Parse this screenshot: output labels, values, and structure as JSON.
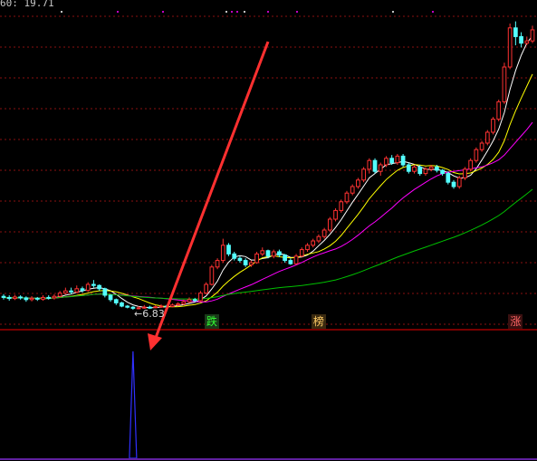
{
  "header": {
    "text": "60: 19.71"
  },
  "chart_data": [
    {
      "type": "candlestick",
      "title": "",
      "price_range": [
        6.5,
        20.5
      ],
      "low_label": "6.83",
      "candles": [
        [
          7.45,
          7.4,
          7.55,
          7.3
        ],
        [
          7.4,
          7.35,
          7.5,
          7.25
        ],
        [
          7.35,
          7.42,
          7.52,
          7.28
        ],
        [
          7.42,
          7.38,
          7.5,
          7.3
        ],
        [
          7.38,
          7.3,
          7.45,
          7.2
        ],
        [
          7.3,
          7.36,
          7.46,
          7.22
        ],
        [
          7.36,
          7.32,
          7.42,
          7.24
        ],
        [
          7.32,
          7.4,
          7.5,
          7.25
        ],
        [
          7.4,
          7.38,
          7.5,
          7.3
        ],
        [
          7.38,
          7.45,
          7.55,
          7.3
        ],
        [
          7.45,
          7.6,
          7.7,
          7.4
        ],
        [
          7.6,
          7.7,
          7.85,
          7.55
        ],
        [
          7.7,
          7.65,
          7.85,
          7.55
        ],
        [
          7.65,
          7.8,
          7.95,
          7.6
        ],
        [
          7.8,
          7.72,
          7.9,
          7.62
        ],
        [
          7.72,
          8.0,
          8.1,
          7.65
        ],
        [
          8.0,
          7.95,
          8.2,
          7.85
        ],
        [
          7.95,
          7.8,
          8.0,
          7.7
        ],
        [
          7.8,
          7.5,
          7.85,
          7.4
        ],
        [
          7.5,
          7.3,
          7.55,
          7.2
        ],
        [
          7.3,
          7.15,
          7.35,
          7.05
        ],
        [
          7.15,
          7.0,
          7.2,
          6.95
        ],
        [
          7.0,
          6.95,
          7.05,
          6.9
        ],
        [
          6.95,
          6.9,
          7.0,
          6.83
        ],
        [
          6.9,
          6.92,
          7.0,
          6.85
        ],
        [
          6.92,
          6.95,
          7.05,
          6.88
        ],
        [
          6.95,
          6.93,
          7.02,
          6.87
        ],
        [
          6.93,
          6.97,
          7.05,
          6.9
        ],
        [
          6.97,
          7.0,
          7.08,
          6.92
        ],
        [
          7.0,
          6.98,
          7.06,
          6.94
        ],
        [
          6.98,
          7.05,
          7.12,
          6.95
        ],
        [
          7.05,
          7.1,
          7.18,
          7.0
        ],
        [
          7.1,
          7.2,
          7.3,
          7.05
        ],
        [
          7.2,
          7.3,
          7.4,
          7.15
        ],
        [
          7.3,
          7.25,
          7.38,
          7.18
        ],
        [
          7.25,
          7.6,
          7.7,
          7.2
        ],
        [
          7.6,
          8.0,
          8.1,
          7.55
        ],
        [
          8.0,
          8.8,
          8.9,
          7.95
        ],
        [
          8.8,
          9.1,
          9.2,
          8.7
        ],
        [
          9.1,
          9.8,
          10.1,
          9.0
        ],
        [
          9.8,
          9.4,
          9.9,
          9.3
        ],
        [
          9.4,
          9.2,
          9.5,
          9.1
        ],
        [
          9.2,
          9.1,
          9.3,
          9.0
        ],
        [
          9.1,
          8.9,
          9.2,
          8.8
        ],
        [
          8.9,
          9.0,
          9.1,
          8.8
        ],
        [
          9.0,
          9.4,
          9.5,
          8.95
        ],
        [
          9.4,
          9.55,
          9.7,
          9.3
        ],
        [
          9.55,
          9.3,
          9.6,
          9.2
        ],
        [
          9.3,
          9.5,
          9.6,
          9.2
        ],
        [
          9.5,
          9.35,
          9.6,
          9.25
        ],
        [
          9.35,
          9.1,
          9.4,
          9.0
        ],
        [
          9.1,
          8.95,
          9.2,
          8.9
        ],
        [
          8.95,
          9.3,
          9.4,
          8.9
        ],
        [
          9.3,
          9.6,
          9.7,
          9.25
        ],
        [
          9.6,
          9.8,
          9.9,
          9.5
        ],
        [
          9.8,
          10.0,
          10.1,
          9.7
        ],
        [
          10.0,
          10.2,
          10.3,
          9.9
        ],
        [
          10.2,
          10.5,
          10.6,
          10.1
        ],
        [
          10.5,
          11.0,
          11.1,
          10.4
        ],
        [
          11.0,
          11.4,
          11.5,
          10.9
        ],
        [
          11.4,
          11.8,
          11.9,
          11.3
        ],
        [
          11.8,
          12.2,
          12.3,
          11.7
        ],
        [
          12.2,
          12.5,
          12.6,
          12.1
        ],
        [
          12.5,
          12.8,
          12.9,
          12.4
        ],
        [
          12.8,
          13.3,
          13.4,
          12.7
        ],
        [
          13.3,
          13.7,
          13.8,
          13.1
        ],
        [
          13.7,
          13.2,
          13.8,
          13.1
        ],
        [
          13.2,
          13.5,
          13.6,
          13.0
        ],
        [
          13.5,
          13.8,
          13.9,
          13.4
        ],
        [
          13.8,
          13.6,
          13.95,
          13.5
        ],
        [
          13.6,
          13.9,
          14.0,
          13.5
        ],
        [
          13.9,
          13.5,
          14.0,
          13.4
        ],
        [
          13.5,
          13.2,
          13.6,
          13.1
        ],
        [
          13.2,
          13.4,
          13.5,
          13.1
        ],
        [
          13.4,
          13.1,
          13.5,
          13.0
        ],
        [
          13.1,
          13.3,
          13.4,
          13.0
        ],
        [
          13.3,
          13.4,
          13.5,
          13.2
        ],
        [
          13.4,
          13.25,
          13.5,
          13.15
        ],
        [
          13.25,
          13.1,
          13.3,
          13.0
        ],
        [
          13.1,
          12.7,
          13.2,
          12.6
        ],
        [
          12.7,
          12.5,
          12.8,
          12.4
        ],
        [
          12.5,
          12.9,
          13.0,
          12.4
        ],
        [
          12.9,
          13.3,
          13.4,
          12.8
        ],
        [
          13.3,
          13.7,
          13.8,
          13.2
        ],
        [
          13.7,
          14.2,
          14.3,
          13.6
        ],
        [
          14.2,
          14.5,
          14.6,
          14.1
        ],
        [
          14.5,
          15.0,
          15.1,
          14.4
        ],
        [
          15.0,
          15.6,
          15.7,
          14.9
        ],
        [
          15.6,
          16.4,
          16.5,
          15.5
        ],
        [
          16.4,
          18.0,
          18.2,
          16.3
        ],
        [
          18.0,
          19.8,
          20.0,
          17.9
        ],
        [
          19.8,
          19.4,
          20.1,
          19.0
        ],
        [
          19.4,
          19.1,
          19.6,
          18.9
        ],
        [
          19.1,
          19.2,
          19.4,
          19.0
        ],
        [
          19.2,
          19.71,
          19.9,
          19.1
        ]
      ],
      "overlays": [
        {
          "name": "",
          "color": "#ffffff"
        },
        {
          "name": "",
          "color": "#ffff00"
        },
        {
          "name": "",
          "color": "#ff00ff"
        },
        {
          "name": "",
          "color": "#00c000"
        }
      ],
      "signals": [
        {
          "label": "跌",
          "candle_index": 37,
          "bg": "#1a3a1a",
          "color": "#33ff33"
        },
        {
          "label": "榜",
          "candle_index": 56,
          "bg": "#3a2a10",
          "color": "#ffcc66"
        },
        {
          "label": "涨",
          "candle_index": 91,
          "bg": "#3a1010",
          "color": "#ff6666"
        }
      ]
    },
    {
      "type": "bar",
      "title": "",
      "values": [
        0,
        0,
        0,
        0,
        0,
        0,
        0,
        0,
        0,
        0,
        0,
        0,
        0,
        0,
        0,
        0,
        0,
        0,
        0,
        0,
        0,
        0,
        0,
        1,
        0,
        0,
        0,
        0,
        0,
        0,
        0,
        0,
        0,
        0,
        0,
        0,
        0,
        0,
        0,
        0,
        0,
        0,
        0,
        0,
        0,
        0,
        0,
        0,
        0,
        0,
        0,
        0,
        0,
        0,
        0,
        0,
        0,
        0,
        0,
        0,
        0,
        0,
        0,
        0,
        0,
        0,
        0,
        0,
        0,
        0,
        0,
        0,
        0,
        0,
        0,
        0,
        0,
        0,
        0,
        0,
        0,
        0,
        0,
        0,
        0,
        0,
        0,
        0,
        0,
        0,
        0,
        0,
        0,
        0,
        0
      ],
      "ylim": [
        0,
        1.05
      ],
      "color": "#3030ff"
    }
  ],
  "annotation_arrow": {
    "color": "#ff3030"
  }
}
